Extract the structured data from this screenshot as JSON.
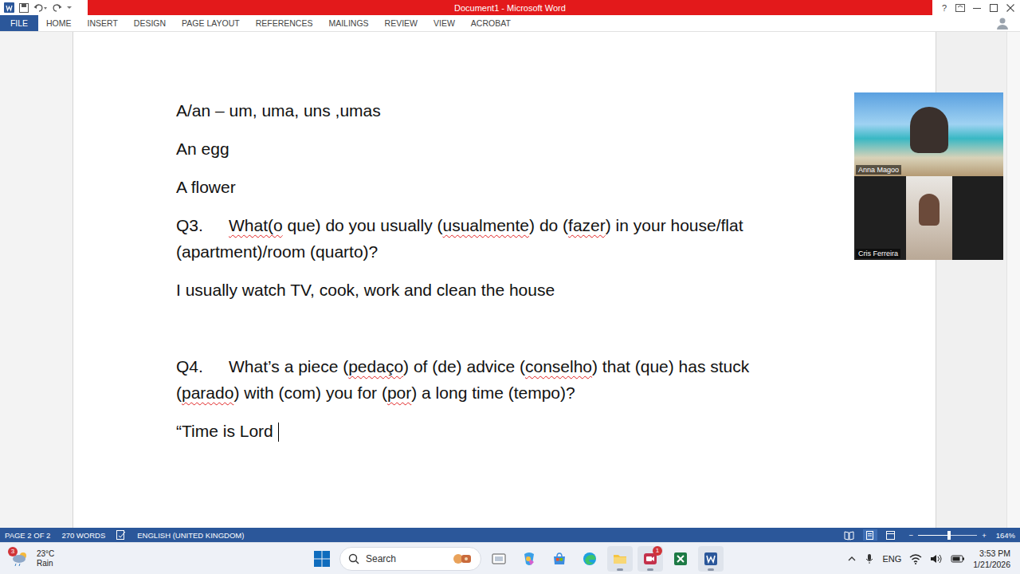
{
  "window": {
    "title": "Document1 - Microsoft Word",
    "help": "?"
  },
  "ribbon_tabs": [
    {
      "label": "FILE",
      "kind": "file"
    },
    {
      "label": "HOME",
      "kind": "tab"
    },
    {
      "label": "INSERT",
      "kind": "tab"
    },
    {
      "label": "DESIGN",
      "kind": "tab"
    },
    {
      "label": "PAGE LAYOUT",
      "kind": "tab"
    },
    {
      "label": "REFERENCES",
      "kind": "tab"
    },
    {
      "label": "MAILINGS",
      "kind": "tab"
    },
    {
      "label": "REVIEW",
      "kind": "tab"
    },
    {
      "label": "VIEW",
      "kind": "tab"
    },
    {
      "label": "ACROBAT",
      "kind": "tab"
    }
  ],
  "document": {
    "paragraphs": [
      {
        "label": "",
        "cursor": false,
        "segments": [
          {
            "text": "A/an – um, uma, uns ,umas",
            "misspelled": false
          }
        ]
      },
      {
        "label": "",
        "cursor": false,
        "segments": [
          {
            "text": "An egg",
            "misspelled": false
          }
        ]
      },
      {
        "label": "",
        "cursor": false,
        "segments": [
          {
            "text": "A flower",
            "misspelled": false
          }
        ]
      },
      {
        "label": "Q3.",
        "cursor": false,
        "segments": [
          {
            "text": "What(o",
            "misspelled": true
          },
          {
            "text": " que) do you usually (",
            "misspelled": false
          },
          {
            "text": "usualmente",
            "misspelled": true
          },
          {
            "text": ") do (",
            "misspelled": false
          },
          {
            "text": "fazer",
            "misspelled": true
          },
          {
            "text": ") in your house/flat (apartment)/room (quarto)?",
            "misspelled": false
          }
        ]
      },
      {
        "label": "",
        "cursor": false,
        "segments": [
          {
            "text": "I usually watch TV, cook, work and clean the house",
            "misspelled": false
          }
        ]
      },
      {
        "label": "",
        "cursor": false,
        "segments": []
      },
      {
        "label": "Q4.",
        "cursor": false,
        "segments": [
          {
            "text": "What’s a piece (",
            "misspelled": false
          },
          {
            "text": "pedaço",
            "misspelled": true
          },
          {
            "text": ") of (de) advice (",
            "misspelled": false
          },
          {
            "text": "conselho",
            "misspelled": true
          },
          {
            "text": ") that (que) has stuck (",
            "misspelled": false
          },
          {
            "text": "parado",
            "misspelled": true
          },
          {
            "text": ") with (com) you for (",
            "misspelled": false
          },
          {
            "text": "por",
            "misspelled": true
          },
          {
            "text": ") a long time (tempo)?",
            "misspelled": false
          }
        ]
      },
      {
        "label": "",
        "cursor": true,
        "segments": [
          {
            "text": "“Time is Lord ",
            "misspelled": false
          }
        ]
      }
    ]
  },
  "video_call": {
    "participants": [
      {
        "name": "Anna Magoo",
        "kind": "full"
      },
      {
        "name": "Cris Ferreira",
        "kind": "inset"
      }
    ]
  },
  "status_bar": {
    "page": "PAGE 2 OF 2",
    "words": "270 WORDS",
    "language": "ENGLISH (UNITED KINGDOM)",
    "views": [
      {
        "selected": false
      },
      {
        "selected": true
      },
      {
        "selected": false
      }
    ],
    "zoom": {
      "minus": "−",
      "plus": "+",
      "level": 0.52,
      "reading": "164%"
    }
  },
  "taskbar": {
    "weather": {
      "badge": "3",
      "temperature": "23°C",
      "condition": "Rain"
    },
    "search": {
      "placeholder": "Search"
    },
    "apps": [
      {
        "running": false,
        "badge": ""
      },
      {
        "running": false,
        "badge": ""
      },
      {
        "running": false,
        "badge": ""
      },
      {
        "running": false,
        "badge": ""
      },
      {
        "running": true,
        "badge": ""
      },
      {
        "running": true,
        "badge": "1"
      },
      {
        "running": false,
        "badge": ""
      },
      {
        "running": true,
        "badge": ""
      }
    ],
    "tray": {
      "language": "ENG",
      "time": "3:53 PM",
      "date": "1/21/2026"
    }
  }
}
